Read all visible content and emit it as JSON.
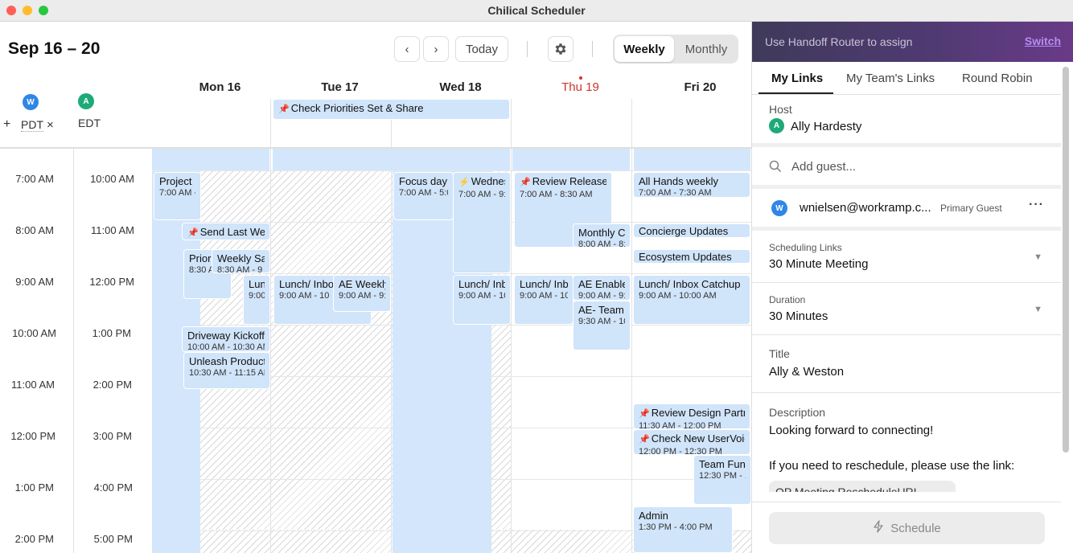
{
  "window": {
    "title": "Chilical Scheduler",
    "colors": {
      "close": "#ff5f57",
      "minimize": "#febc2e",
      "zoom": "#28c840"
    }
  },
  "calendar": {
    "range_title": "Sep 16 – 20",
    "nav": {
      "prev_icon": "chevron-left-icon",
      "next_icon": "chevron-right-icon",
      "today_label": "Today",
      "settings_icon": "gear-icon"
    },
    "view": {
      "weekly": "Weekly",
      "monthly": "Monthly",
      "selected": "Weekly"
    },
    "days": [
      {
        "label": "Mon 16",
        "today": false
      },
      {
        "label": "Tue 17",
        "today": false
      },
      {
        "label": "Wed 18",
        "today": false
      },
      {
        "label": "Thu 19",
        "today": true
      },
      {
        "label": "Fri 20",
        "today": false
      }
    ],
    "today_color": "#d0342c",
    "timezones": [
      {
        "avatar": "W",
        "label": "PDT",
        "avatar_color": "#2f86e8"
      },
      {
        "avatar": "A",
        "label": "EDT",
        "avatar_color": "#1eaa78"
      }
    ],
    "tz_add": "+",
    "tz_remove": "×",
    "times_pdt": [
      "7:00 AM",
      "8:00 AM",
      "9:00 AM",
      "10:00 AM",
      "11:00 AM",
      "12:00 PM",
      "1:00 PM",
      "2:00 PM"
    ],
    "times_edt": [
      "10:00 AM",
      "11:00 AM",
      "12:00 PM",
      "1:00 PM",
      "2:00 PM",
      "3:00 PM",
      "4:00 PM",
      "5:00 PM"
    ],
    "allday_event": "Check Priorities Set & Share",
    "events": [
      {
        "title": "Project Fo",
        "time": "7:00 AM - 1"
      },
      {
        "title": "Send Last Week",
        "time": "",
        "icon": "pin"
      },
      {
        "title": "Prior",
        "time": "8:30 A"
      },
      {
        "title": "Weekly Sa",
        "time": "8:30 AM - 9"
      },
      {
        "title": "Lunc",
        "time": "9:00 /"
      },
      {
        "title": "Driveway Kickoff!",
        "time": "10:00 AM - 10:30 AM"
      },
      {
        "title": "Unleash Product F",
        "time": "10:30 AM - 11:15 AM"
      },
      {
        "title": "Lunch/ Inbo",
        "time": "9:00 AM - 10"
      },
      {
        "title": "AE Weekly",
        "time": "9:00 AM - 9:4"
      },
      {
        "title": "Focus day",
        "time": "7:00 AM - 5:0"
      },
      {
        "title": "Wednes",
        "time": "7:00 AM - 9:0",
        "icon": "bolt"
      },
      {
        "title": "Lunch/ Inbo",
        "time": "9:00 AM - 10"
      },
      {
        "title": "Review Releases",
        "time": "7:00 AM - 8:30 AM",
        "icon": "pin"
      },
      {
        "title": "Monthly Co",
        "time": "8:00 AM - 8:"
      },
      {
        "title": "Lunch/ Inbo",
        "time": "9:00 AM - 10"
      },
      {
        "title": "AE Enablem",
        "time": "9:00 AM - 9:3"
      },
      {
        "title": "AE- Team T",
        "time": "9:30 AM - 10"
      },
      {
        "title": "All Hands weekly",
        "time": "7:00 AM - 7:30 AM"
      },
      {
        "title": "Concierge Updates",
        "time": ""
      },
      {
        "title": "Ecosystem Updates",
        "time": ""
      },
      {
        "title": "Lunch/ Inbox Catchup",
        "time": "9:00 AM - 10:00 AM"
      },
      {
        "title": "Review Design Partne",
        "time": "11:30 AM - 12:00 PM",
        "icon": "pin"
      },
      {
        "title": "Check New UserVoice",
        "time": "12:00 PM - 12:30 PM",
        "icon": "pin"
      },
      {
        "title": "Team Fun T",
        "time": "12:30 PM - 1"
      },
      {
        "title": "Admin",
        "time": "1:30 PM - 4:00 PM"
      }
    ]
  },
  "panel": {
    "banner": {
      "text": "Use Handoff Router to assign",
      "link": "Switch"
    },
    "tabs": [
      "My Links",
      "My Team's Links",
      "Round Robin"
    ],
    "active_tab": "My Links",
    "host": {
      "label": "Host",
      "avatar": "A",
      "name": "Ally  Hardesty"
    },
    "guest_search": {
      "placeholder": "Add guest...",
      "icon": "search-icon"
    },
    "guest": {
      "avatar": "W",
      "email": "wnielsen@workramp.c...",
      "tag": "Primary Guest",
      "menu_icon": "more-horizontal-icon"
    },
    "scheduling_links": {
      "label": "Scheduling Links",
      "value": "30 Minute Meeting"
    },
    "duration": {
      "label": "Duration",
      "value": "30 Minutes"
    },
    "title": {
      "label": "Title",
      "value": "Ally & Weston"
    },
    "description": {
      "label": "Description",
      "line1": "Looking forward to connecting!",
      "line2": "If you need to reschedule, please use the link:",
      "chip": "OP Meeting RescheduleURL"
    },
    "schedule_button": "Schedule"
  }
}
